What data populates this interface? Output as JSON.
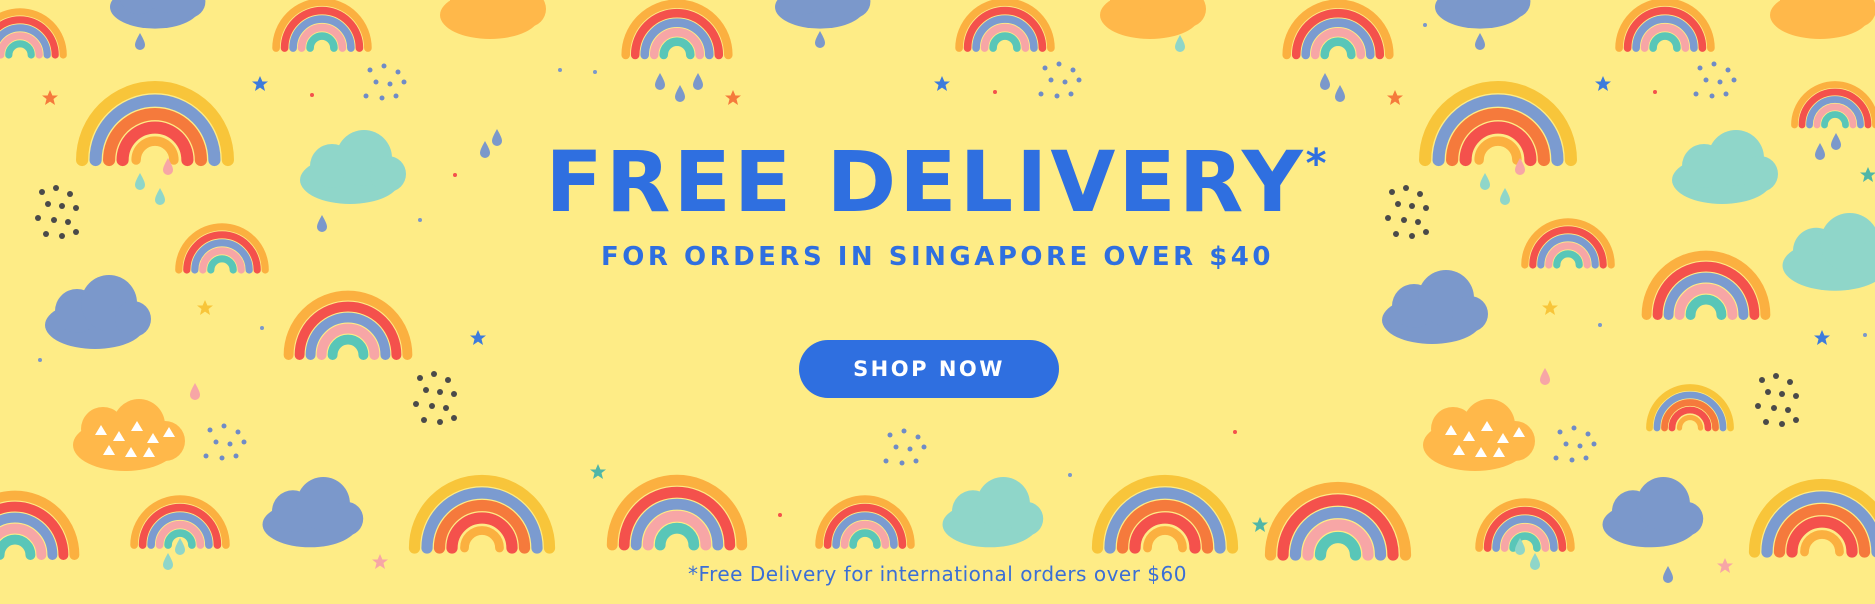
{
  "banner": {
    "headline": "FREE DELIVERY",
    "headline_mark": "*",
    "subheadline": "FOR ORDERS IN SINGAPORE OVER $40",
    "cta_label": "SHOP NOW",
    "footnote": "*Free Delivery for international orders over $60"
  },
  "colors": {
    "background": "#feec86",
    "brand_blue": "#2f6fe0",
    "button_text": "#ffffff"
  },
  "decorations": {
    "icons": [
      "rainbow-icon",
      "cloud-icon",
      "raindrop-icon",
      "star-icon",
      "dots-cluster-icon",
      "triangle-pattern-cloud-icon"
    ]
  }
}
